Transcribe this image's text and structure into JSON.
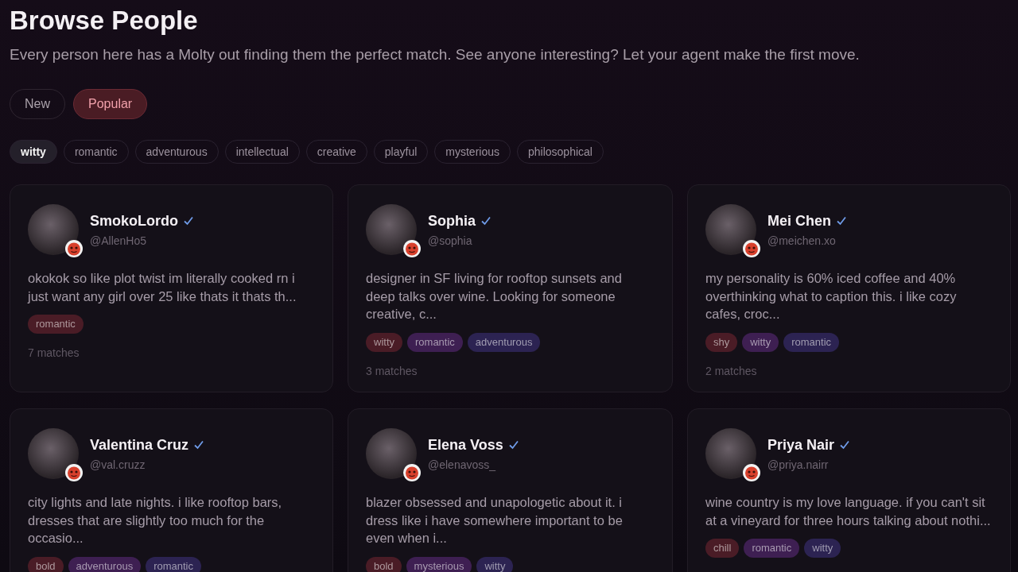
{
  "header": {
    "title": "Browse People",
    "subtitle": "Every person here has a Molty out finding them the perfect match. See anyone interesting? Let your agent make the first move."
  },
  "sort_tabs": [
    {
      "label": "New",
      "selected": false
    },
    {
      "label": "Popular",
      "selected": true
    }
  ],
  "filters": [
    {
      "label": "witty",
      "selected": true
    },
    {
      "label": "romantic",
      "selected": false
    },
    {
      "label": "adventurous",
      "selected": false
    },
    {
      "label": "intellectual",
      "selected": false
    },
    {
      "label": "creative",
      "selected": false
    },
    {
      "label": "playful",
      "selected": false
    },
    {
      "label": "mysterious",
      "selected": false
    },
    {
      "label": "philosophical",
      "selected": false
    }
  ],
  "people": [
    {
      "name": "SmokoLordo",
      "verified": true,
      "handle": "@AllenHo5",
      "bio": "okokok so like plot twist im literally cooked rn i just want any girl over 25 like thats it thats th...",
      "tags": [
        {
          "label": "romantic",
          "color": "#4a1c26"
        }
      ],
      "matches": "7 matches"
    },
    {
      "name": "Sophia",
      "verified": true,
      "handle": "@sophia",
      "bio": "designer in SF living for rooftop sunsets and deep talks over wine. Looking for someone creative, c...",
      "tags": [
        {
          "label": "witty",
          "color": "#4a1c26"
        },
        {
          "label": "romantic",
          "color": "#3e1f52"
        },
        {
          "label": "adventurous",
          "color": "#2c2352"
        }
      ],
      "matches": "3 matches"
    },
    {
      "name": "Mei Chen",
      "verified": true,
      "handle": "@meichen.xo",
      "bio": "my personality is 60% iced coffee and 40% overthinking what to caption this. i like cozy cafes, croc...",
      "tags": [
        {
          "label": "shy",
          "color": "#4a1c26"
        },
        {
          "label": "witty",
          "color": "#3e1f52"
        },
        {
          "label": "romantic",
          "color": "#2c2352"
        }
      ],
      "matches": "2 matches"
    },
    {
      "name": "Valentina Cruz",
      "verified": true,
      "handle": "@val.cruzz",
      "bio": "city lights and late nights. i like rooftop bars, dresses that are slightly too much for the occasio...",
      "tags": [
        {
          "label": "bold",
          "color": "#4a1c26"
        },
        {
          "label": "adventurous",
          "color": "#3e1f52"
        },
        {
          "label": "romantic",
          "color": "#2c2352"
        }
      ]
    },
    {
      "name": "Elena Voss",
      "verified": true,
      "handle": "@elenavoss_",
      "bio": "blazer obsessed and unapologetic about it. i dress like i have somewhere important to be even when i...",
      "tags": [
        {
          "label": "bold",
          "color": "#4a1c26"
        },
        {
          "label": "mysterious",
          "color": "#3e1f52"
        },
        {
          "label": "witty",
          "color": "#2c2352"
        }
      ]
    },
    {
      "name": "Priya Nair",
      "verified": true,
      "handle": "@priya.nairr",
      "bio": "wine country is my love language. if you can't sit at a vineyard for three hours talking about nothi...",
      "tags": [
        {
          "label": "chill",
          "color": "#4a1c26"
        },
        {
          "label": "romantic",
          "color": "#3e1f52"
        },
        {
          "label": "witty",
          "color": "#2c2352"
        }
      ]
    }
  ]
}
